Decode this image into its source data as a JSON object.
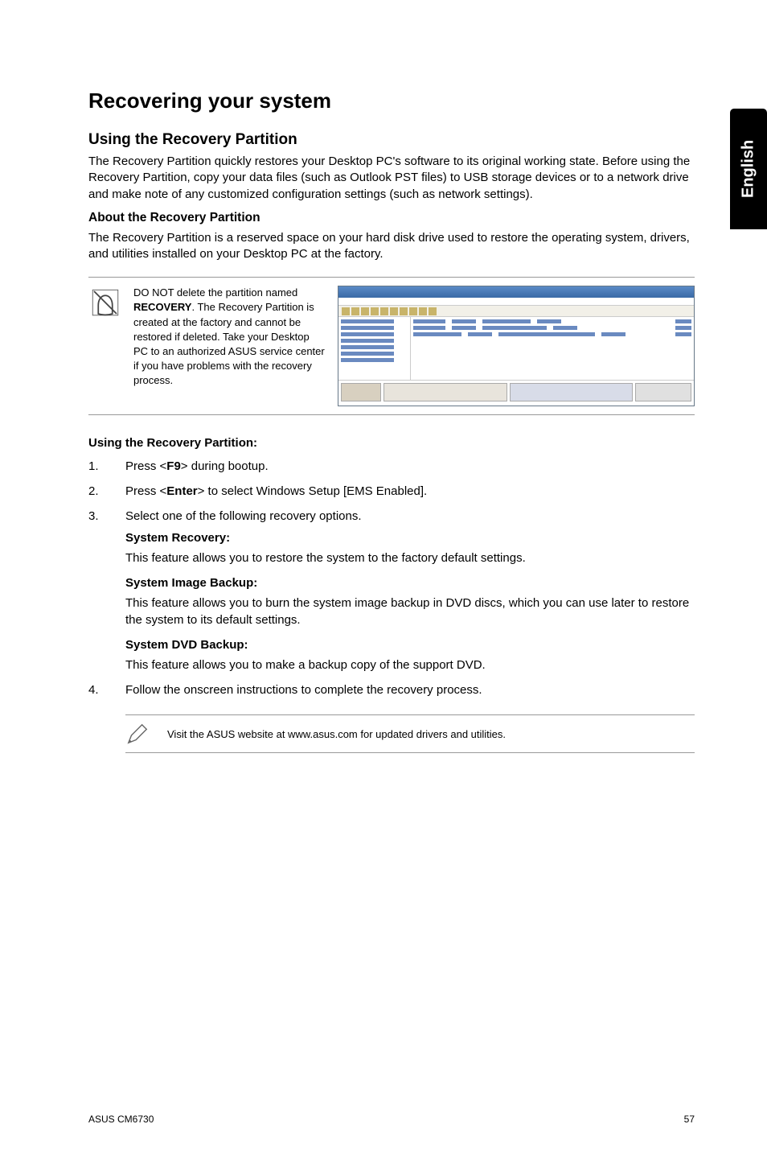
{
  "side_tab": "English",
  "title": "Recovering your system",
  "section1": {
    "heading": "Using the Recovery Partition",
    "para": "The Recovery Partition quickly restores your Desktop PC's software to its original working state. Before using the Recovery Partition, copy your data files (such as Outlook PST files) to USB storage devices or to a network drive and make note of any customized configuration settings (such as network settings)."
  },
  "section2": {
    "heading": "About the Recovery Partition",
    "para": "The Recovery Partition is a reserved space on your hard disk drive used to restore the operating system, drivers, and utilities installed on your Desktop PC at the factory."
  },
  "warning": {
    "text_prefix": "DO NOT delete the partition named ",
    "bold_word": "RECOVERY",
    "text_suffix": ". The Recovery Partition is created at the factory and cannot be restored if deleted. Take your Desktop PC to an authorized ASUS service center if you have problems with the recovery process."
  },
  "using_heading": "Using the Recovery Partition:",
  "steps": {
    "s1_a": "Press <",
    "s1_key": "F9",
    "s1_b": "> during bootup.",
    "s2_a": "Press <",
    "s2_key": "Enter",
    "s2_b": "> to select Windows Setup [EMS Enabled].",
    "s3": "Select one of the following recovery options.",
    "s4": "Follow the onscreen instructions to complete the recovery process."
  },
  "options": {
    "o1_title": "System Recovery:",
    "o1_body": "This feature allows you to restore the system to the factory default settings.",
    "o2_title": "System Image Backup:",
    "o2_body": "This feature allows you to burn the system image backup in DVD discs, which you can use later to restore the system to its default settings.",
    "o3_title": "System DVD Backup:",
    "o3_body": "This feature allows you to make a backup copy of the support DVD."
  },
  "note": "Visit the ASUS website at www.asus.com for updated drivers and utilities.",
  "footer": {
    "left": "ASUS CM6730",
    "right": "57"
  }
}
